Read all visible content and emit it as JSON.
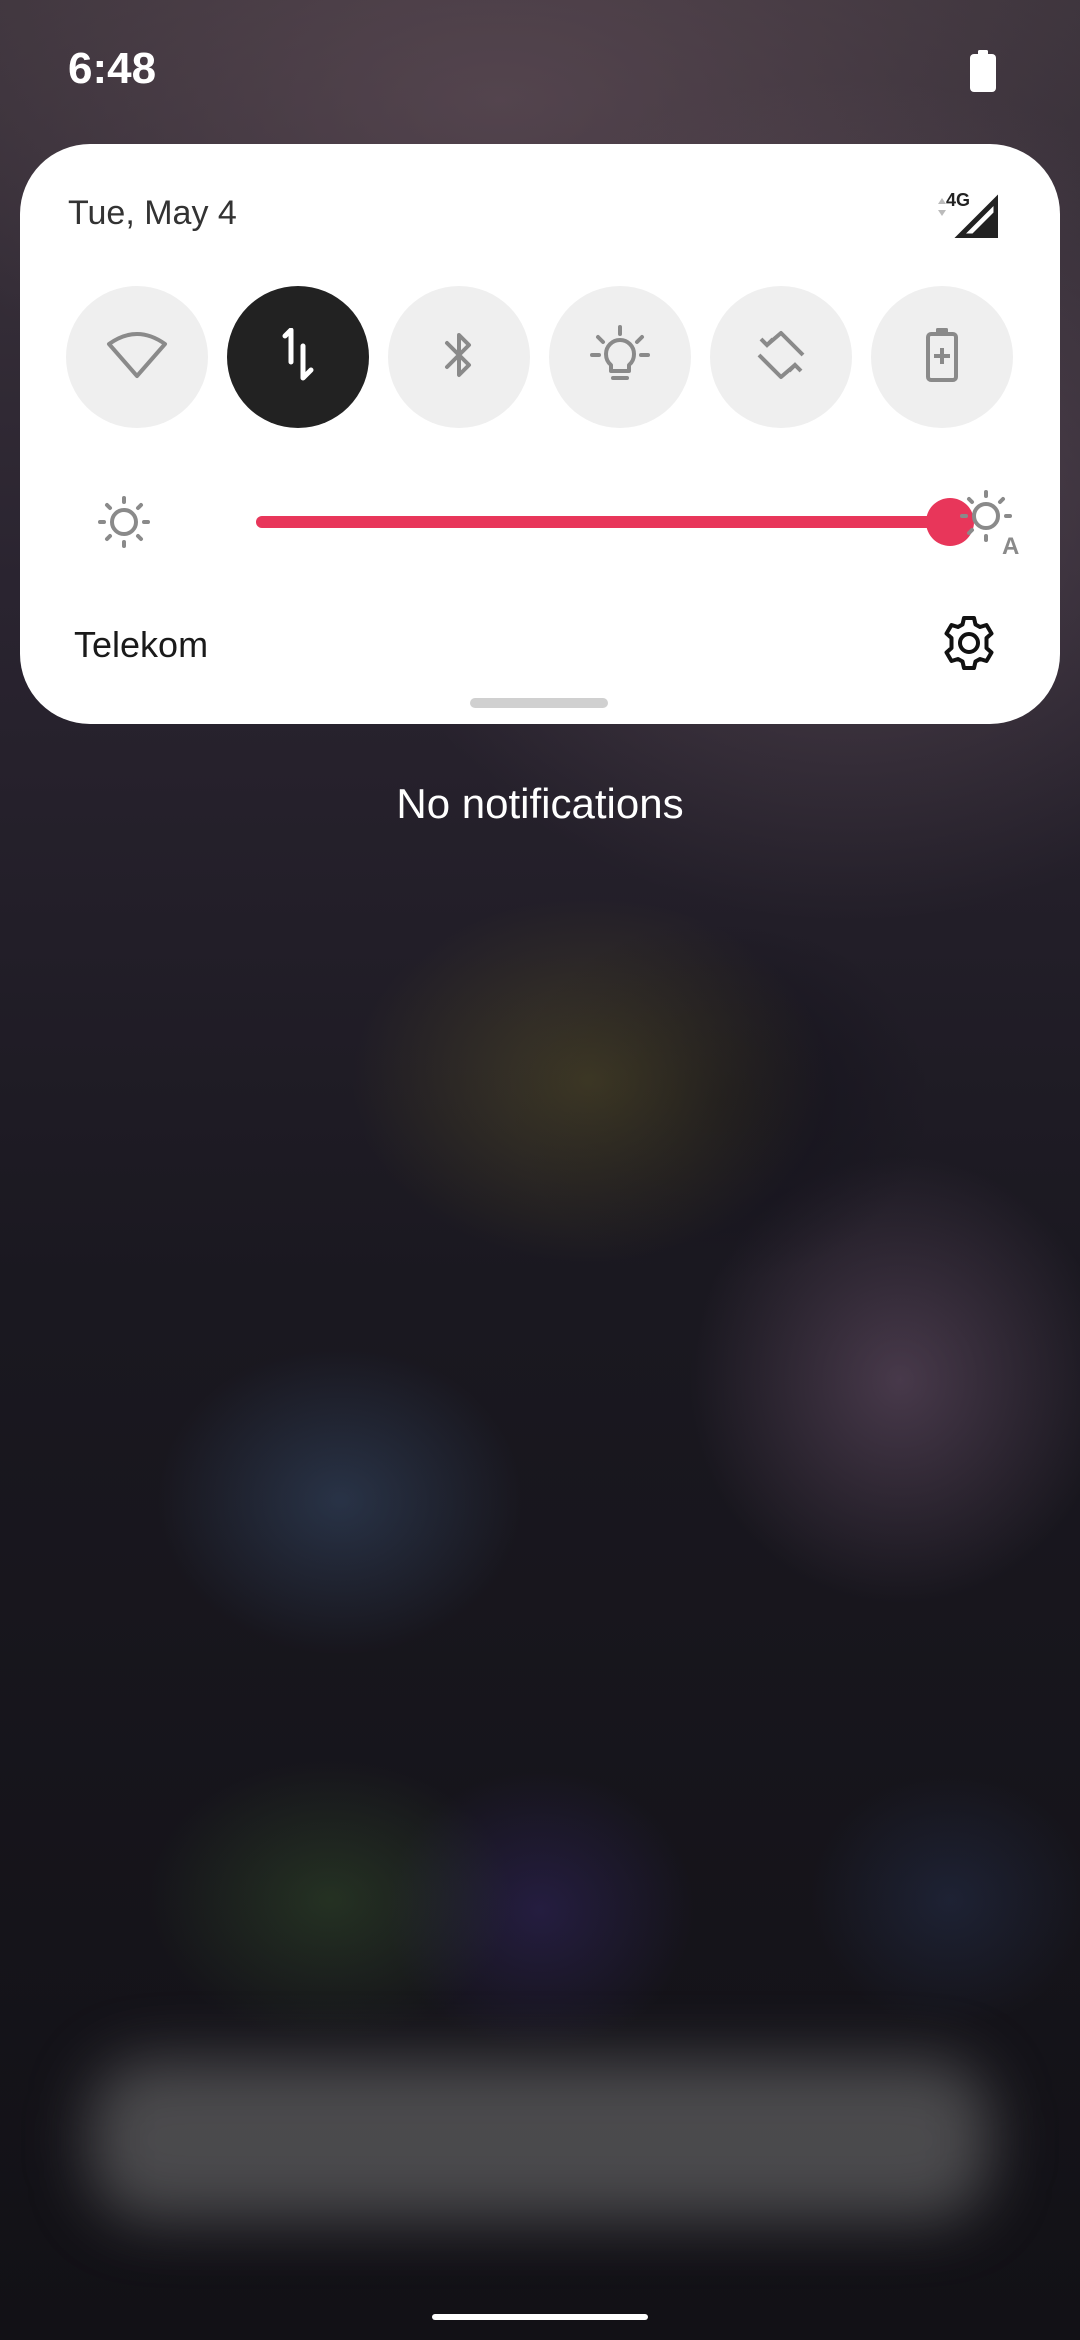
{
  "status_bar": {
    "time": "6:48",
    "icons": [
      "battery-icon"
    ]
  },
  "quick_settings": {
    "date": "Tue, May 4",
    "network_type": "4G",
    "tiles": [
      {
        "name": "wifi",
        "icon": "wifi-icon",
        "active": false
      },
      {
        "name": "mobile-data",
        "icon": "mobile-data-icon",
        "active": true
      },
      {
        "name": "bluetooth",
        "icon": "bluetooth-icon",
        "active": false
      },
      {
        "name": "flashlight",
        "icon": "flashlight-icon",
        "active": false
      },
      {
        "name": "auto-rotate",
        "icon": "auto-rotate-icon",
        "active": false
      },
      {
        "name": "battery-saver",
        "icon": "battery-saver-icon",
        "active": false
      }
    ],
    "brightness": {
      "level": 1.0,
      "min_icon": "brightness-low-icon",
      "auto_icon": "brightness-auto-icon"
    },
    "carrier": "Telekom",
    "settings_icon": "gear-icon"
  },
  "notifications": {
    "empty_text": "No notifications"
  },
  "colors": {
    "accent": "#e8365a",
    "active_tile": "#222222",
    "inactive_tile": "#efefef",
    "icon_gray": "#8a8a8a"
  }
}
